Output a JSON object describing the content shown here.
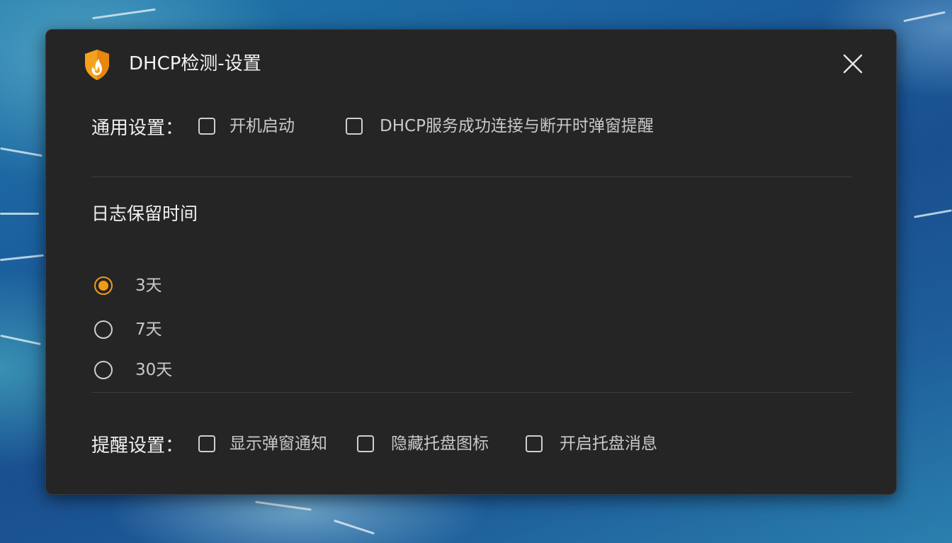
{
  "window": {
    "title": "DHCP检测-设置",
    "app_icon": "shield-flame-icon",
    "close_icon": "close-icon"
  },
  "general": {
    "label": "通用设置：",
    "options": [
      {
        "label": "开机启动",
        "checked": false
      },
      {
        "label": "DHCP服务成功连接与断开时弹窗提醒",
        "checked": false
      }
    ]
  },
  "log_retention": {
    "label": "日志保留时间",
    "options": [
      {
        "label": "3天",
        "selected": true
      },
      {
        "label": "7天",
        "selected": false
      },
      {
        "label": "30天",
        "selected": false
      }
    ]
  },
  "reminder": {
    "label": "提醒设置：",
    "options": [
      {
        "label": "显示弹窗通知",
        "checked": false
      },
      {
        "label": "隐藏托盘图标",
        "checked": false
      },
      {
        "label": "开启托盘消息",
        "checked": false
      }
    ]
  },
  "colors": {
    "accent": "#f29a16",
    "window_bg": "#252525",
    "text": "#e6e6e6"
  }
}
